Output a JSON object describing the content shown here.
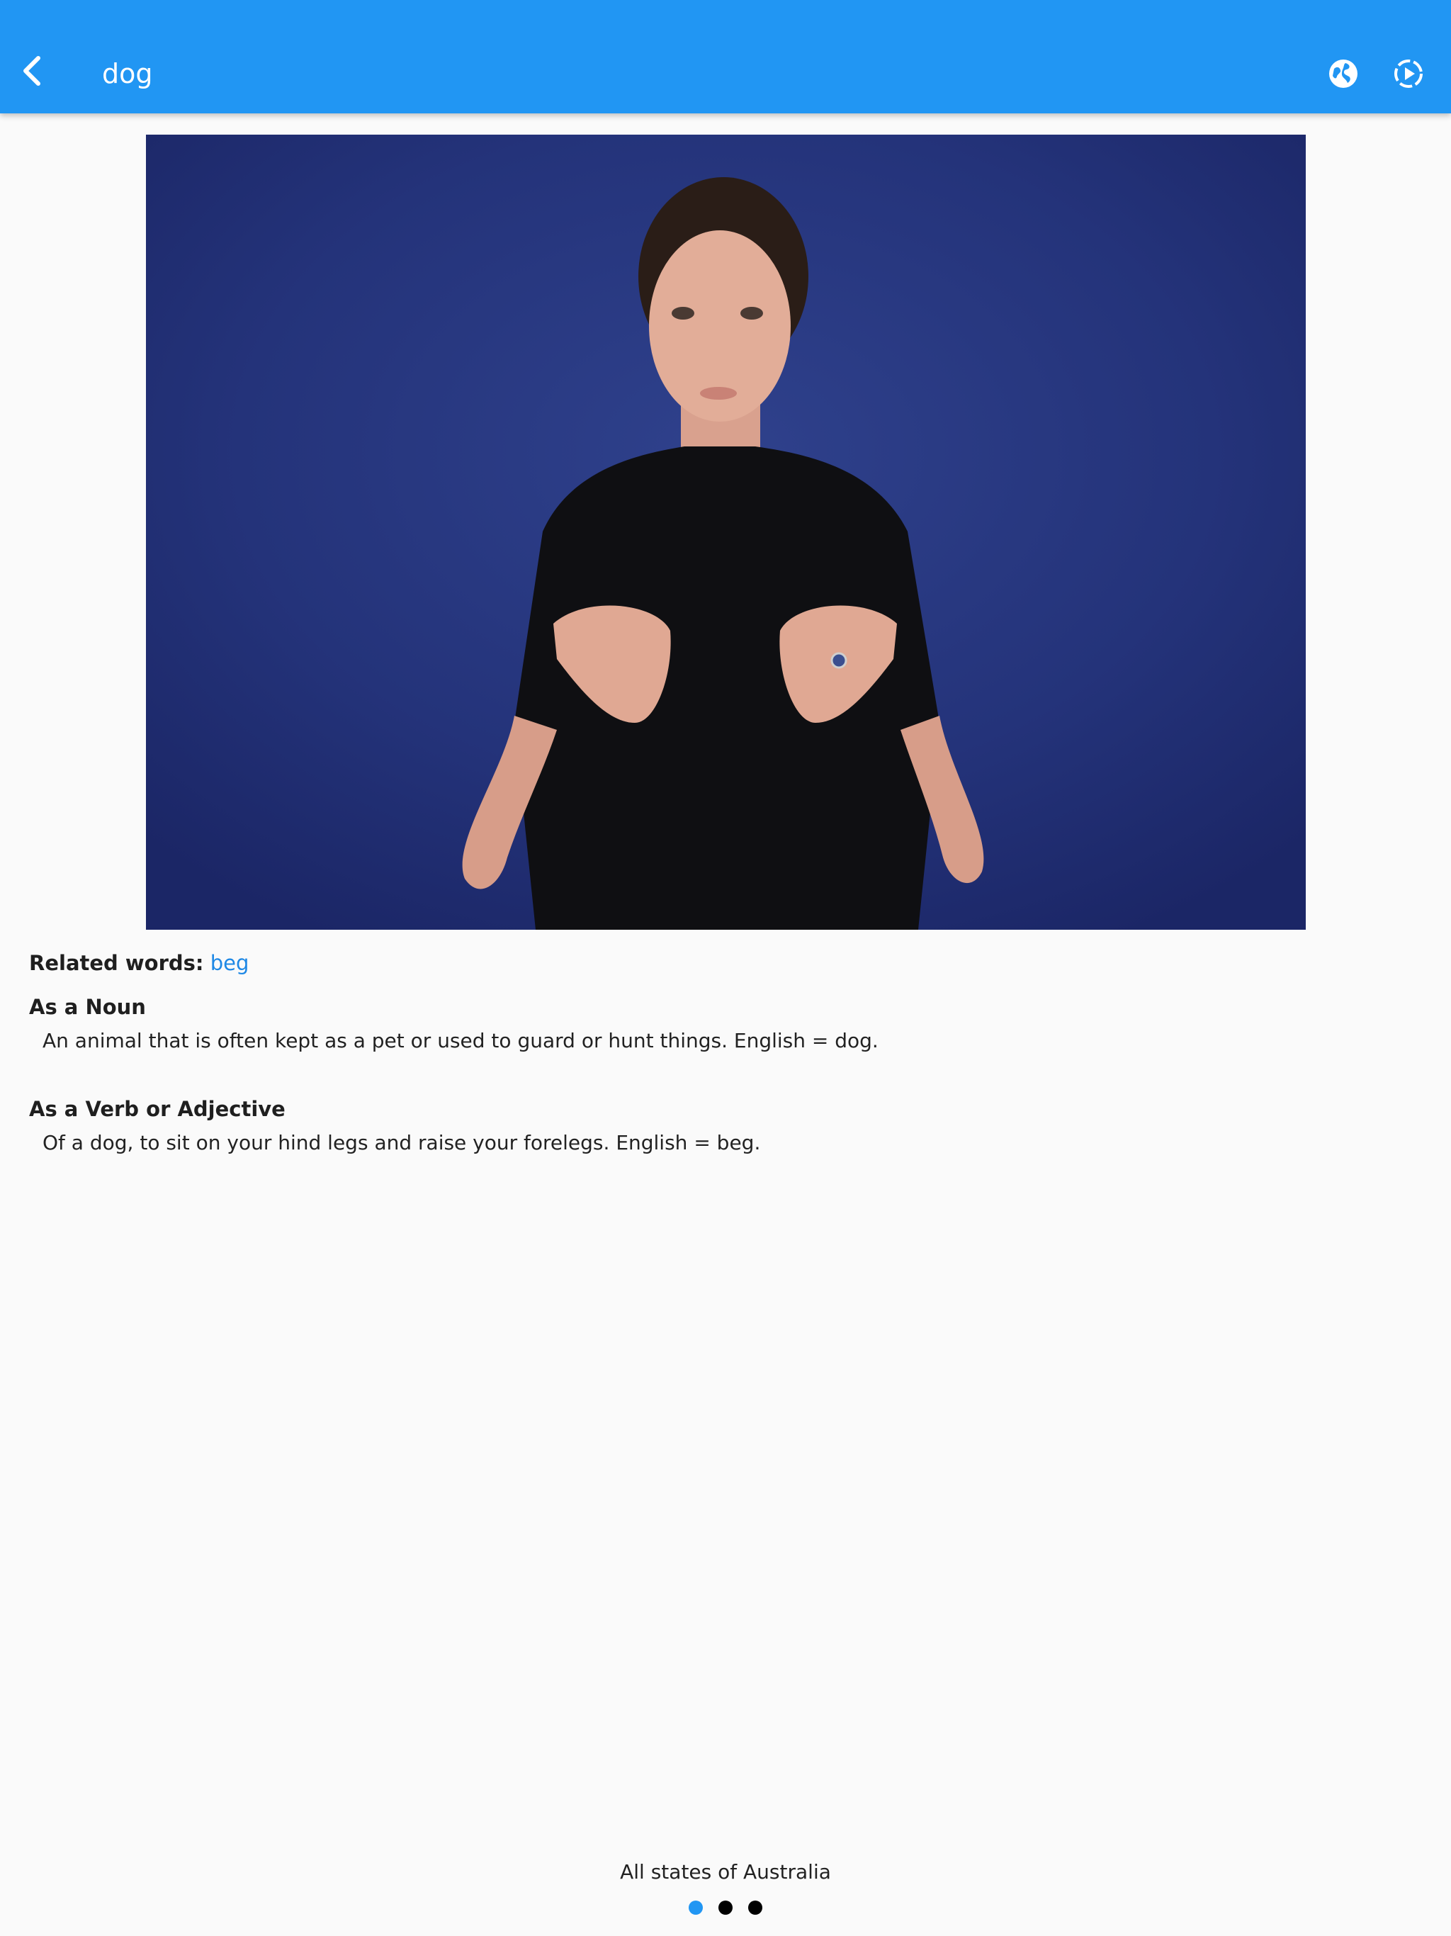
{
  "app_bar": {
    "title": "dog",
    "back_icon": "chevron-left-icon",
    "actions": [
      {
        "icon": "globe-icon"
      },
      {
        "icon": "replay-icon"
      }
    ],
    "color": "#2196f3"
  },
  "video": {
    "description_icon": "sign-video"
  },
  "related": {
    "label": "Related words:",
    "words": [
      "beg"
    ]
  },
  "senses": [
    {
      "heading": "As a Noun",
      "definition": "An animal that is often kept as a pet or used to guard or hunt things. English = dog."
    },
    {
      "heading": "As a Verb or Adjective",
      "definition": "Of a dog, to sit on your hind legs and raise your forelegs. English = beg."
    }
  ],
  "footer": {
    "region": "All states of Australia",
    "page_count": 3,
    "active_page": 1,
    "active_color": "#2196f3"
  }
}
